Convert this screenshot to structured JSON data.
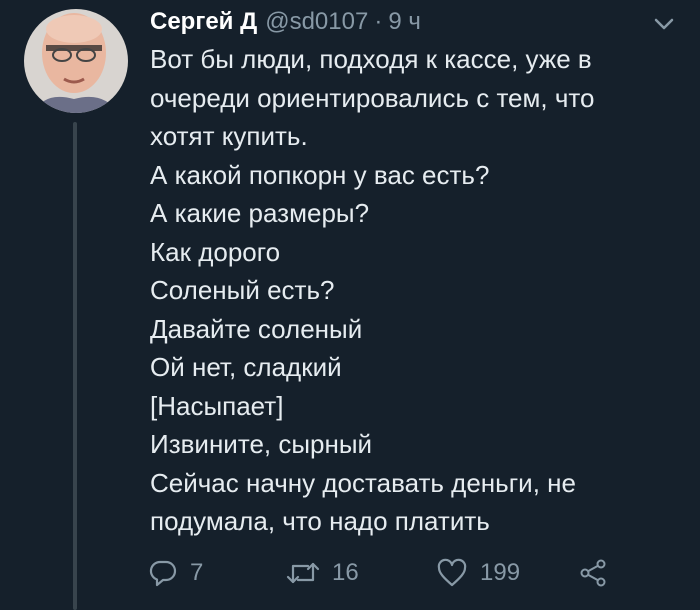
{
  "tweet": {
    "author_name": "Сергей Д",
    "handle": "@sd0107",
    "separator": "·",
    "time": "9 ч",
    "lines": [
      "Вот бы люди, подходя к кассе, уже в",
      "очереди ориентировались с тем, что",
      "хотят купить.",
      "А какой попкорн у вас есть?",
      "А какие размеры?",
      "Как дорого",
      "Соленый есть?",
      "Давайте соленый",
      "Ой нет, сладкий",
      "[Насыпает]",
      "Извините, сырный",
      "Сейчас начну доставать деньги, не",
      "подумала, что надо платить"
    ]
  },
  "actions": {
    "replies": "7",
    "retweets": "16",
    "likes": "199"
  },
  "icons": {
    "reply": "reply-icon",
    "retweet": "retweet-icon",
    "like": "heart-icon",
    "share": "share-icon",
    "menu": "chevron-down-icon"
  },
  "colors": {
    "background": "#15202b",
    "text": "#e6ecf0",
    "muted": "#8899a6",
    "thread_line": "#38444d"
  }
}
